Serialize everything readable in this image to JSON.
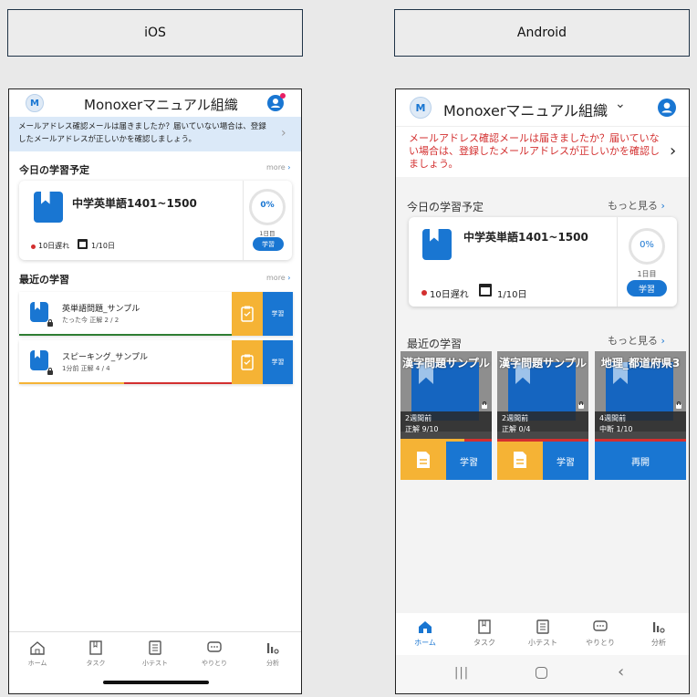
{
  "headers": {
    "ios": "iOS",
    "android": "Android"
  },
  "ios": {
    "org": "Monoxerマニュアル組織",
    "avatar_letter": "M",
    "notice": "メールアドレス確認メールは届きましたか？届いていない場合は、登録したメールアドレスが正しいかを確認しましょう。",
    "today": {
      "title": "今日の学習予定",
      "more": "more",
      "item": "中学英単語1401~1500",
      "late": "10日遅れ",
      "date": "1/10日",
      "progress": "0%",
      "days": "1日目",
      "study": "学習"
    },
    "recent": {
      "title": "最近の学習",
      "more": "more",
      "items": [
        {
          "name": "英単語問題_サンプル",
          "meta": "たった今  正解  2 / 2",
          "study": "学習"
        },
        {
          "name": "スピーキング_サンプル",
          "meta": "1分前  正解  4 / 4",
          "study": "学習"
        }
      ]
    },
    "nav": [
      "ホーム",
      "タスク",
      "小テスト",
      "やりとり",
      "分析"
    ]
  },
  "android": {
    "org": "Monoxerマニュアル組織",
    "avatar_letter": "M",
    "notice": "メールアドレス確認メールは届きましたか？届いていない場合は、登録したメールアドレスが正しいかを確認しましょう。",
    "today": {
      "title": "今日の学習予定",
      "more": "もっと見る",
      "item": "中学英単語1401~1500",
      "late": "10日遅れ",
      "date": "1/10日",
      "progress": "0%",
      "days": "1日目",
      "study": "学習"
    },
    "recent": {
      "title": "最近の学習",
      "more": "もっと見る",
      "tiles": [
        {
          "title": "漢字問題サンプル",
          "time": "2週間前",
          "score": "正解 9/10",
          "action": "学習"
        },
        {
          "title": "漢字問題サンプル",
          "time": "2週間前",
          "score": "正解 0/4",
          "action": "学習"
        },
        {
          "title": "地理_都道府県3",
          "time": "4週間前",
          "score": "中断 1/10",
          "action": "再開"
        }
      ]
    },
    "nav": [
      "ホーム",
      "タスク",
      "小テスト",
      "やりとり",
      "分析"
    ]
  },
  "colors": {
    "accent": "#1976d2",
    "warn": "#d32f2f",
    "orange": "#f5b335",
    "notice_bg": "#dbe9f8"
  }
}
